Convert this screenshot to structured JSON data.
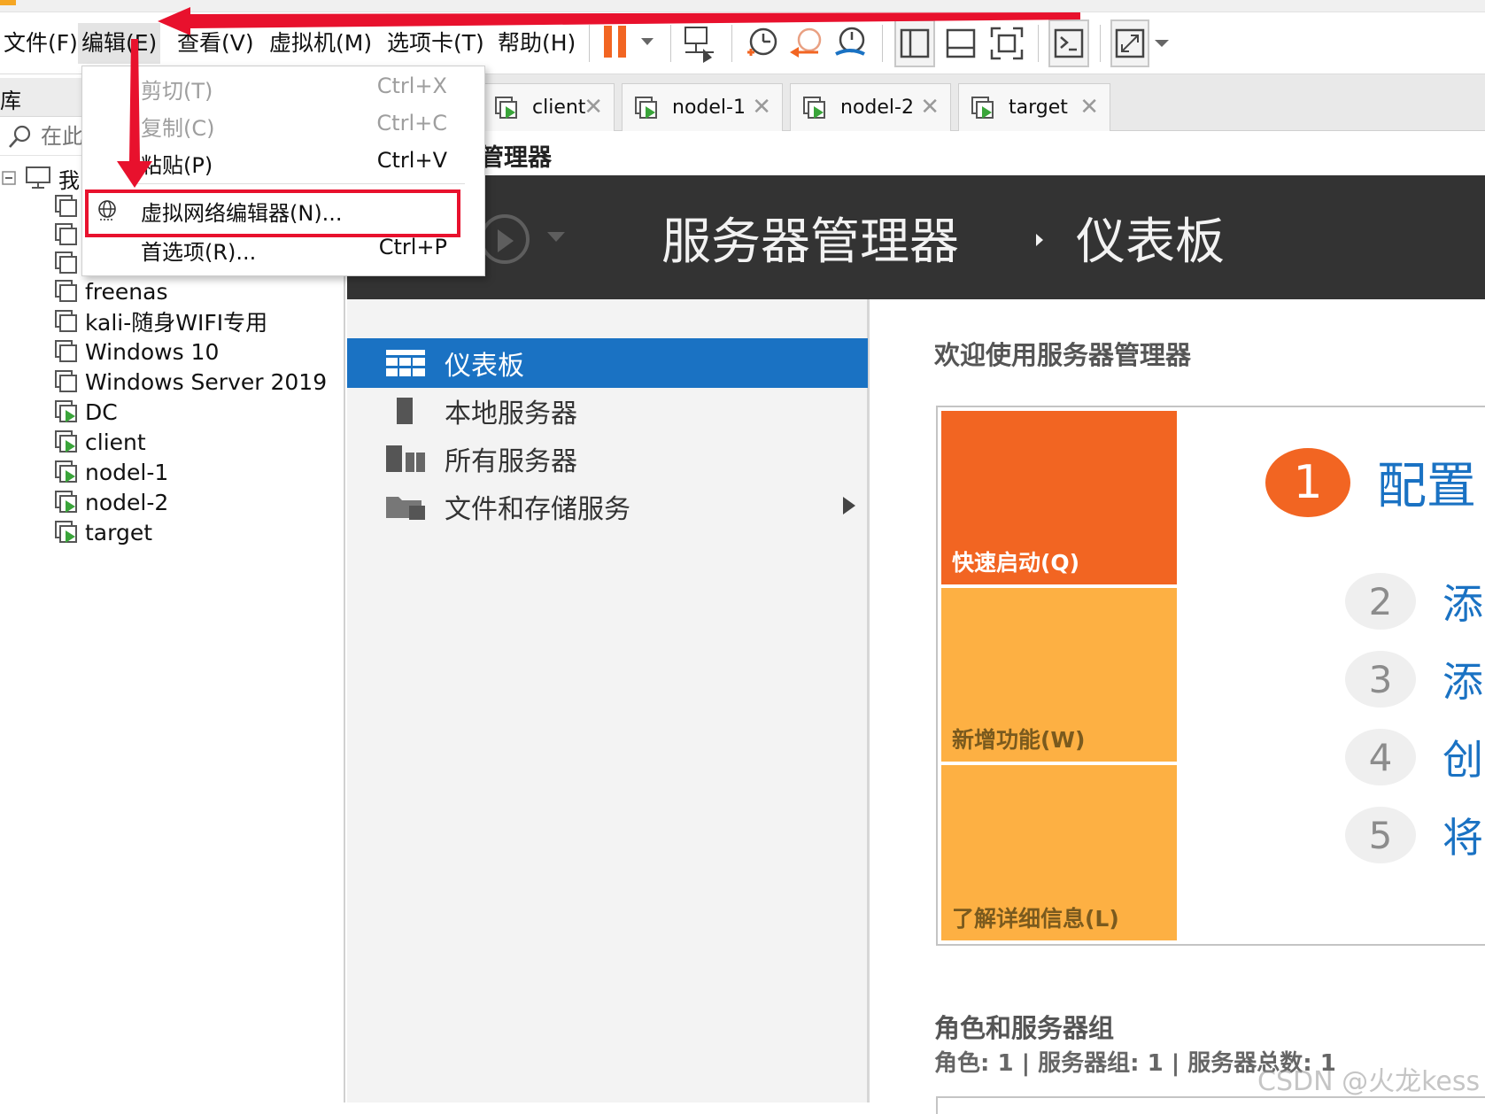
{
  "menubar": {
    "items": [
      "文件(F)",
      "编辑(E)",
      "查看(V)",
      "虚拟机(M)",
      "选项卡(T)",
      "帮助(H)"
    ]
  },
  "library": {
    "title": "库",
    "search_placeholder": "在此",
    "root_label": "我",
    "vms": [
      "freenas",
      "kali-随身WIFI专用",
      "Windows 10",
      "Windows Server 2019",
      "DC",
      "client",
      "nodel-1",
      "nodel-2",
      "target"
    ]
  },
  "tabs": [
    {
      "label": "client"
    },
    {
      "label": "nodel-1"
    },
    {
      "label": "nodel-2"
    },
    {
      "label": "target"
    }
  ],
  "edit_menu": {
    "items": [
      {
        "label": "剪切(T)",
        "shortcut": "Ctrl+X",
        "enabled": false
      },
      {
        "label": "复制(C)",
        "shortcut": "Ctrl+C",
        "enabled": false
      },
      {
        "label": "粘贴(P)",
        "shortcut": "Ctrl+V",
        "enabled": true
      },
      {
        "label": "虚拟网络编辑器(N)...",
        "shortcut": "",
        "enabled": true,
        "icon": "globe-icon",
        "highlighted": true
      },
      {
        "label": "首选项(R)...",
        "shortcut": "Ctrl+P",
        "enabled": true
      }
    ]
  },
  "console": {
    "window_title": "管理器",
    "header_title": "服务器管理器",
    "header_sub": "仪表板",
    "nav": [
      {
        "label": "仪表板",
        "icon": "dashboard-icon",
        "active": true
      },
      {
        "label": "本地服务器",
        "icon": "server-icon",
        "active": false
      },
      {
        "label": "所有服务器",
        "icon": "servers-icon",
        "active": false
      },
      {
        "label": "文件和存储服务",
        "icon": "storage-icon",
        "active": false
      }
    ],
    "welcome": "欢迎使用服务器管理器",
    "tiles": [
      "快速启动(Q)",
      "新增功能(W)",
      "了解详细信息(L)"
    ],
    "steps": [
      {
        "num": "1",
        "text": "配置"
      },
      {
        "num": "2",
        "text": "添"
      },
      {
        "num": "3",
        "text": "添"
      },
      {
        "num": "4",
        "text": "创"
      },
      {
        "num": "5",
        "text": "将"
      }
    ],
    "roles_title": "角色和服务器组",
    "roles_sub": "角色: 1 | 服务器组: 1 | 服务器总数: 1"
  },
  "watermark": "CSDN @火龙kess",
  "colors": {
    "annotation_red": "#e8112d",
    "accent_blue": "#1a72c3",
    "tile_orange": "#f26522",
    "tile_yellow": "#fdb043",
    "header_dark": "#333333"
  }
}
